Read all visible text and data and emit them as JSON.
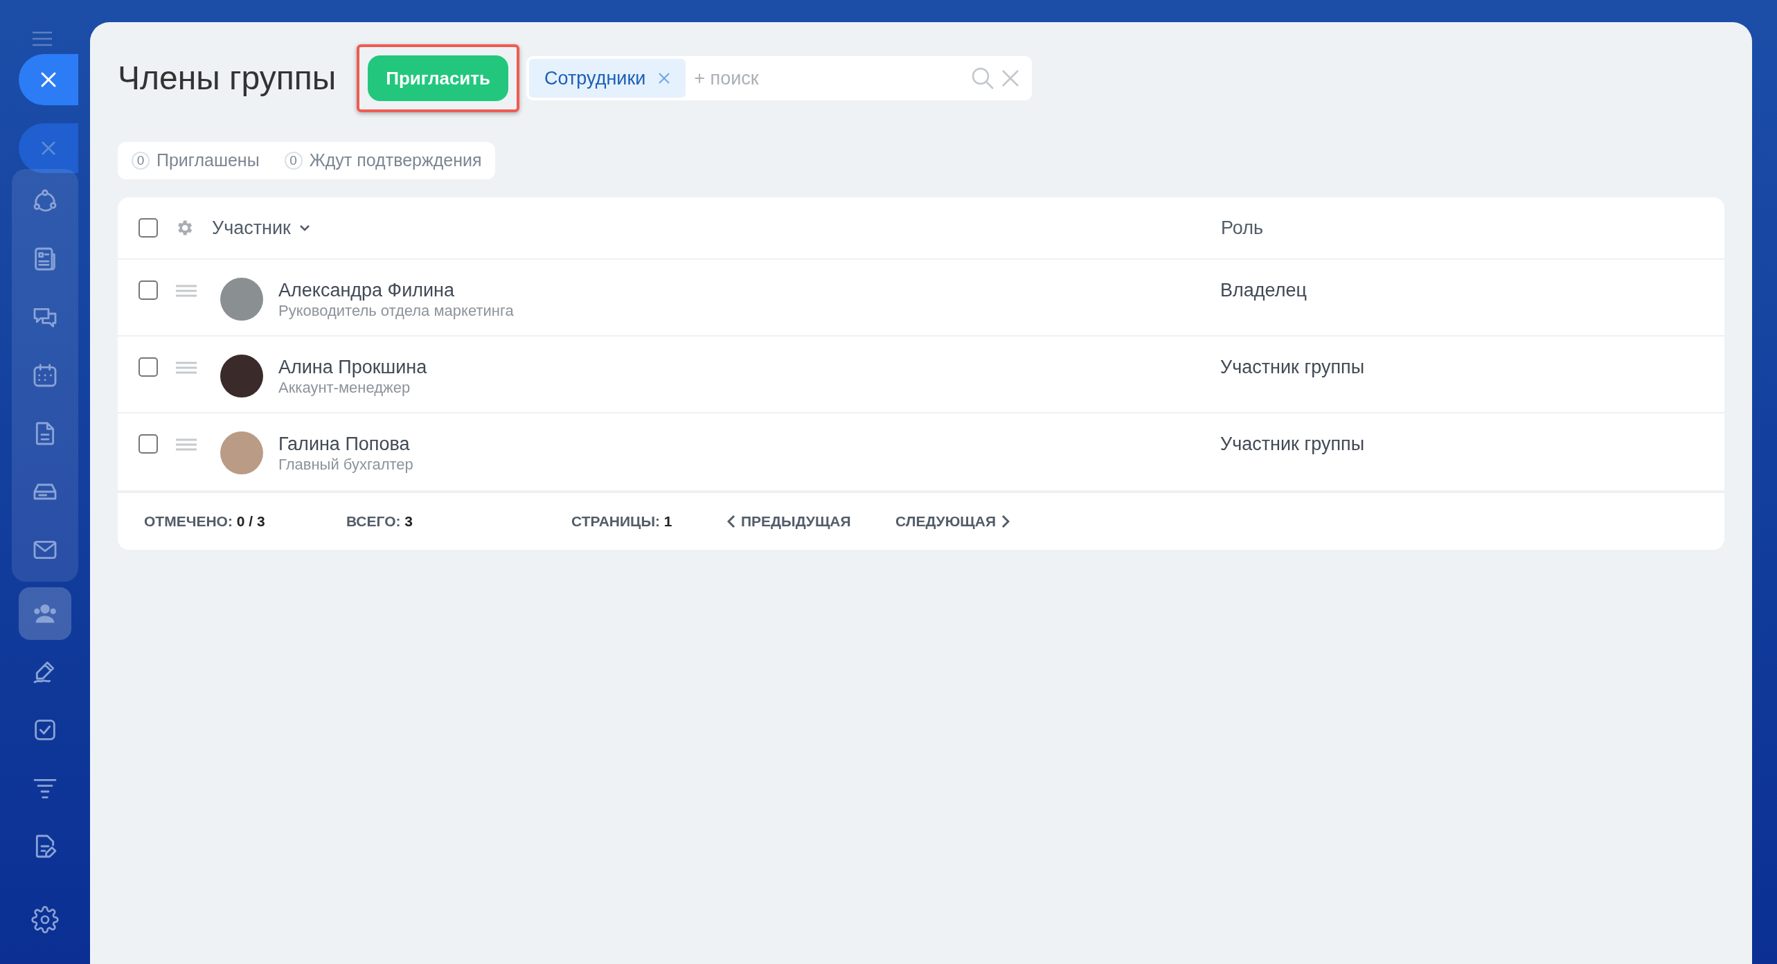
{
  "sidebar": {
    "pinned": [
      {
        "kind": "flow",
        "selected": false
      },
      {
        "kind": "news",
        "selected": false
      },
      {
        "kind": "chat",
        "selected": false
      },
      {
        "kind": "calendar",
        "selected": false
      },
      {
        "kind": "document",
        "selected": false
      },
      {
        "kind": "drive",
        "selected": false
      },
      {
        "kind": "mail",
        "selected": false
      }
    ],
    "items": [
      {
        "kind": "people",
        "selected": true
      },
      {
        "kind": "sign",
        "selected": false
      },
      {
        "kind": "tasks",
        "selected": false
      },
      {
        "kind": "funnel",
        "selected": false
      },
      {
        "kind": "edit-doc",
        "selected": false
      }
    ]
  },
  "title": "Члены группы",
  "invite_button": {
    "label": "Пригласить",
    "highlighted": true
  },
  "search": {
    "tag": "Сотрудники",
    "placeholder": "+ поиск"
  },
  "counters": [
    {
      "count": "0",
      "label": "Приглашены"
    },
    {
      "count": "0",
      "label": "Ждут подтверждения"
    }
  ],
  "table": {
    "columns": [
      "Участник",
      "Роль"
    ],
    "all_checked": false,
    "rows": [
      {
        "name": "Александра Филина",
        "position": "Руководитель отдела маркетинга",
        "role": "Владелец",
        "checked": false
      },
      {
        "name": "Алина Прокшина",
        "position": "Аккаунт-менеджер",
        "role": "Участник группы",
        "checked": false
      },
      {
        "name": "Галина Попова",
        "position": "Главный бухгалтер",
        "role": "Участник группы",
        "checked": false
      }
    ]
  },
  "footer": {
    "checked_label": "ОТМЕЧЕНО:",
    "checked_value": "0 / 3",
    "total_label": "ВСЕГО:",
    "total_value": "3",
    "pages_label": "СТРАНИЦЫ:",
    "pages_value": "1",
    "prev": "ПРЕДЫДУЩАЯ",
    "next": "СЛЕДУЮЩАЯ"
  }
}
